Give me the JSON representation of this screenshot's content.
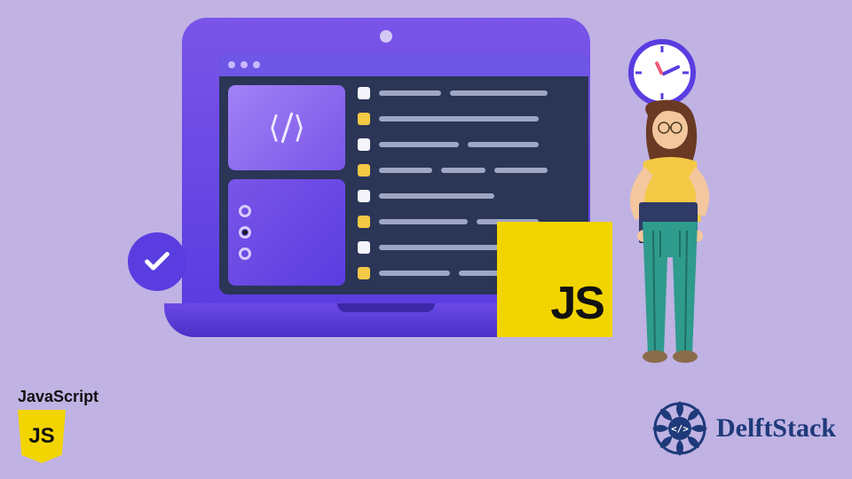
{
  "js_badge_text": "JS",
  "corner": {
    "label": "JavaScript",
    "shield_text": "JS"
  },
  "brand": {
    "name": "DelftStack"
  },
  "icons": {
    "check": "check-icon",
    "clock": "clock-icon",
    "code": "code-brackets-icon",
    "radio_list": "radio-list-icon"
  }
}
